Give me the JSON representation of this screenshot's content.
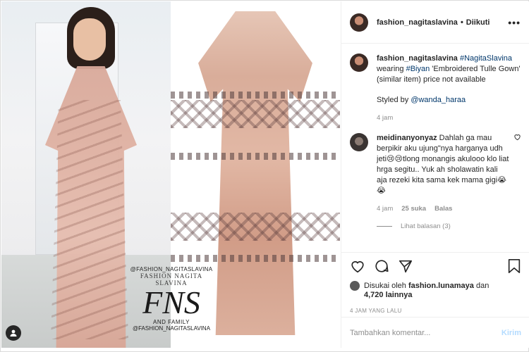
{
  "post": {
    "username": "fashion_nagitaslavina",
    "follow_dot": "•",
    "follow_label": "Diikuti",
    "more_label": "•••"
  },
  "watermark": {
    "handle_top": "@FASHION_NAGITASLAVINA",
    "name": "FASHION NAGITA SLAVINA",
    "logo": "FNS",
    "family": "AND FAMILY",
    "handle_bottom": "@FASHION_NAGITASLAVINA"
  },
  "caption": {
    "username": "fashion_nagitaslavina",
    "hashtag": "#NagitaSlavina",
    "text_1": "wearing",
    "hashtag_2": "#Biyan",
    "text_2": "'Embroidered Tulle Gown' (similar item) price not available",
    "styled_by_prefix": "Styled by",
    "styled_by_tag": "@wanda_haraa",
    "time": "4 jam"
  },
  "comment": {
    "username": "meidinanyonyaz",
    "text": "Dahlah ga mau berpikir aku ujung\"nya harganya udh jeti😢😢tlong monangis akulooo klo liat hrga segitu.. Yuk ah sholawatin kali aja rezeki kita sama kek mama gigi😭😭",
    "time": "4 jam",
    "likes": "25 suka",
    "reply": "Balas",
    "view_replies": "Lihat balasan (3)"
  },
  "likes": {
    "liked_by_prefix": "Disukai oleh",
    "liked_by_user": "fashion.lunamaya",
    "and": "dan",
    "others": "4,720 lainnya"
  },
  "timestamp": "4 JAM YANG LALU",
  "compose": {
    "placeholder": "Tambahkan komentar...",
    "post_label": "Kirim"
  },
  "icons": {
    "heart": "heart-icon",
    "comment": "comment-icon",
    "share": "share-icon",
    "bookmark": "bookmark-icon",
    "more": "more-icon",
    "user_badge": "user-icon"
  },
  "colors": {
    "link": "#00376b",
    "muted": "#8e8e8e",
    "post_button_disabled": "#b3dbff"
  }
}
